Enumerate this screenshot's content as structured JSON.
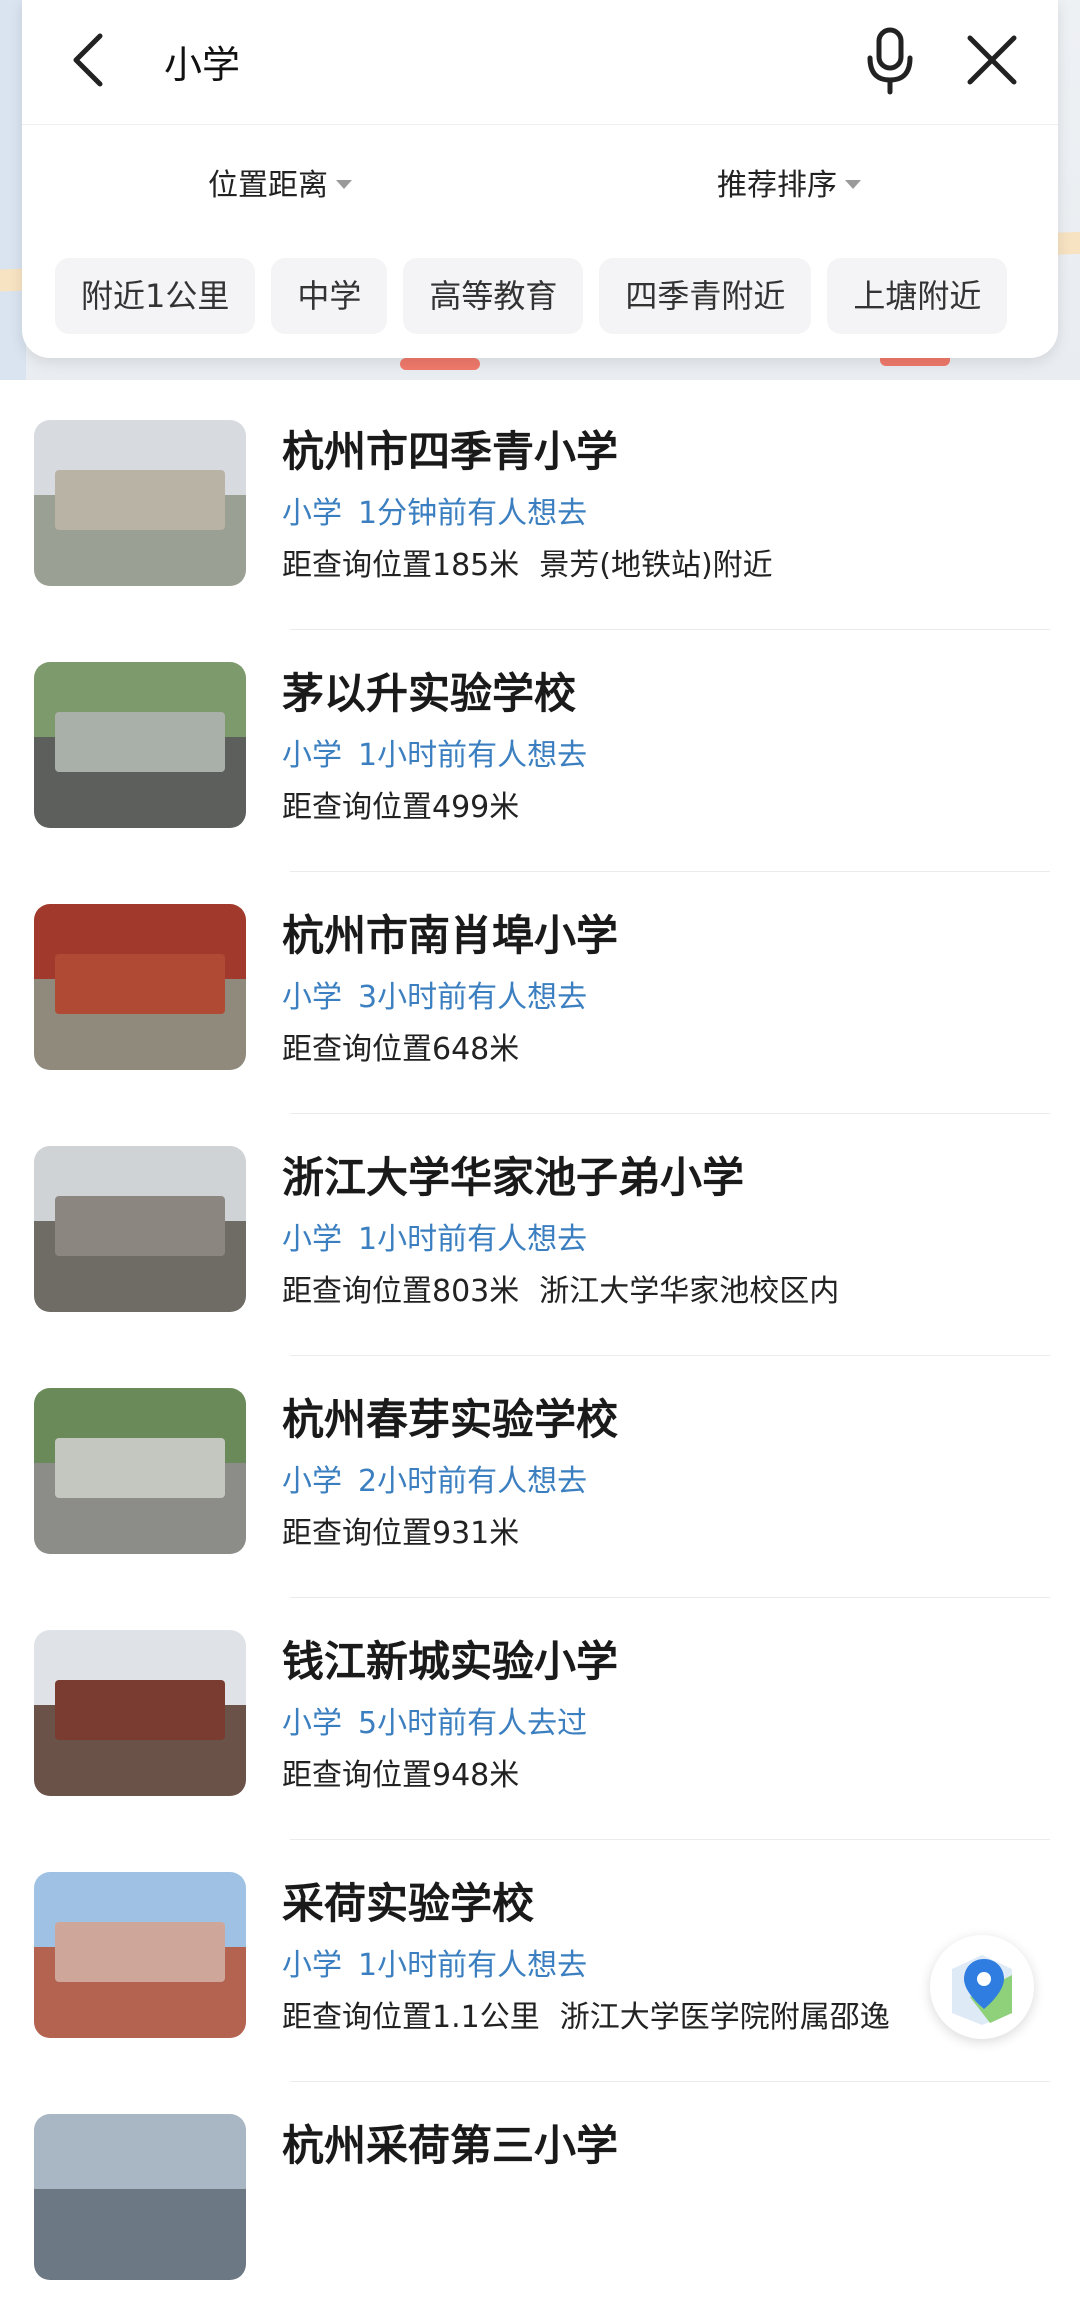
{
  "search": {
    "query": "小学"
  },
  "filters": {
    "distance_label": "位置距离",
    "sort_label": "推荐排序"
  },
  "tags": [
    "附近1公里",
    "中学",
    "高等教育",
    "四季青附近",
    "上塘附近"
  ],
  "results": [
    {
      "name": "杭州市四季青小学",
      "category": "小学",
      "activity": "1分钟前有人想去",
      "distance": "距查询位置185米",
      "extra": "景芳(地铁站)附近"
    },
    {
      "name": "茅以升实验学校",
      "category": "小学",
      "activity": "1小时前有人想去",
      "distance": "距查询位置499米",
      "extra": ""
    },
    {
      "name": "杭州市南肖埠小学",
      "category": "小学",
      "activity": "3小时前有人想去",
      "distance": "距查询位置648米",
      "extra": ""
    },
    {
      "name": "浙江大学华家池子弟小学",
      "category": "小学",
      "activity": "1小时前有人想去",
      "distance": "距查询位置803米",
      "extra": "浙江大学华家池校区内"
    },
    {
      "name": "杭州春芽实验学校",
      "category": "小学",
      "activity": "2小时前有人想去",
      "distance": "距查询位置931米",
      "extra": ""
    },
    {
      "name": "钱江新城实验小学",
      "category": "小学",
      "activity": "5小时前有人去过",
      "distance": "距查询位置948米",
      "extra": ""
    },
    {
      "name": "采荷实验学校",
      "category": "小学",
      "activity": "1小时前有人想去",
      "distance": "距查询位置1.1公里",
      "extra": "浙江大学医学院附属邵逸"
    },
    {
      "name": "杭州采荷第三小学",
      "category": "",
      "activity": "",
      "distance": "",
      "extra": ""
    }
  ],
  "icons": {
    "back": "chevron-left-icon",
    "mic": "microphone-icon",
    "close": "close-icon",
    "location": "map-location-icon"
  },
  "colors": {
    "accent_blue": "#3b7fc0",
    "tag_bg": "#f4f4f6"
  }
}
